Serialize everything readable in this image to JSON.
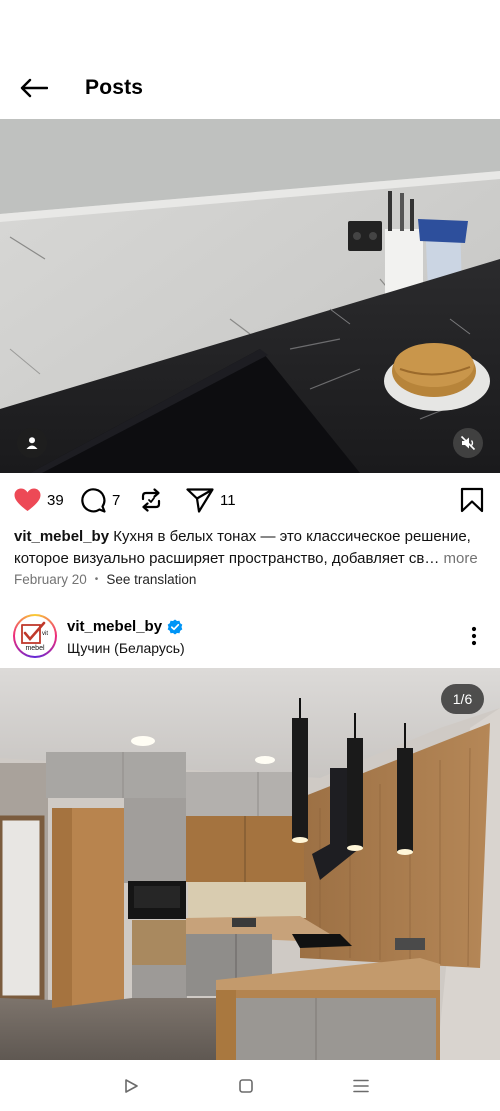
{
  "header": {
    "title": "Posts",
    "back_icon": "arrow-left-icon"
  },
  "post1": {
    "media_type": "video",
    "likes": "39",
    "comments": "7",
    "reposts": "",
    "shares": "11",
    "caption_user": "vit_mebel_by",
    "caption_text": " Кухня в белых тонах — это классическое решение, которое визуально расширяет пространство, добавляет св…",
    "caption_more": " more",
    "date": "February 20",
    "see_translation": "See translation",
    "like_color": "#ed4956"
  },
  "post2": {
    "username": "vit_mebel_by",
    "location": "Щучин (Беларусь)",
    "verified": true,
    "verified_color": "#0095f6",
    "pager": "1/6",
    "avatar_text_top": "vit",
    "avatar_text_bottom": "mebel"
  },
  "navbar": {
    "back_icon": "triangle-back-icon",
    "home_icon": "square-home-icon",
    "recent_icon": "menu-lines-icon"
  }
}
